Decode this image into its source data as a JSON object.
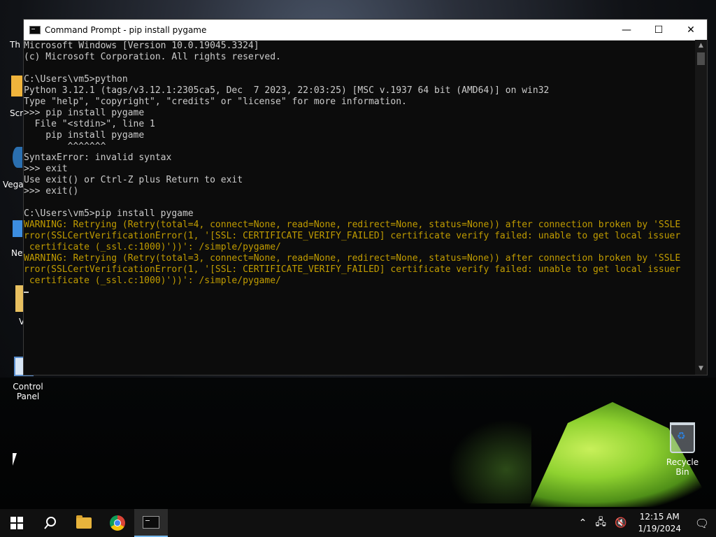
{
  "desktop": {
    "icons": [
      {
        "label": "Th",
        "name": "desktop-icon-this-pc"
      },
      {
        "label": "Scre",
        "name": "desktop-icon-screen"
      },
      {
        "label": "Vegas",
        "name": "desktop-icon-vegas"
      },
      {
        "label": "Net",
        "name": "desktop-icon-network"
      },
      {
        "label": "V",
        "name": "desktop-icon-folder"
      },
      {
        "label": "Control Panel",
        "name": "desktop-icon-control-panel"
      },
      {
        "label": "Recycle Bin",
        "name": "desktop-icon-recycle-bin"
      }
    ]
  },
  "window": {
    "title": "Command Prompt - pip  install pygame",
    "minimize_glyph": "—",
    "maximize_glyph": "☐",
    "close_glyph": "✕",
    "lines": [
      {
        "text": "Microsoft Windows [Version 10.0.19045.3324]",
        "type": "normal"
      },
      {
        "text": "(c) Microsoft Corporation. All rights reserved.",
        "type": "normal"
      },
      {
        "text": "",
        "type": "normal"
      },
      {
        "text": "C:\\Users\\vm5>python",
        "type": "normal"
      },
      {
        "text": "Python 3.12.1 (tags/v3.12.1:2305ca5, Dec  7 2023, 22:03:25) [MSC v.1937 64 bit (AMD64)] on win32",
        "type": "normal"
      },
      {
        "text": "Type \"help\", \"copyright\", \"credits\" or \"license\" for more information.",
        "type": "normal"
      },
      {
        "text": ">>> pip install pygame",
        "type": "normal"
      },
      {
        "text": "  File \"<stdin>\", line 1",
        "type": "normal"
      },
      {
        "text": "    pip install pygame",
        "type": "normal"
      },
      {
        "text": "        ^^^^^^^",
        "type": "normal"
      },
      {
        "text": "SyntaxError: invalid syntax",
        "type": "normal"
      },
      {
        "text": ">>> exit",
        "type": "normal"
      },
      {
        "text": "Use exit() or Ctrl-Z plus Return to exit",
        "type": "normal"
      },
      {
        "text": ">>> exit()",
        "type": "normal"
      },
      {
        "text": "",
        "type": "normal"
      },
      {
        "text": "C:\\Users\\vm5>pip install pygame",
        "type": "normal"
      },
      {
        "text": "WARNING: Retrying (Retry(total=4, connect=None, read=None, redirect=None, status=None)) after connection broken by 'SSLE",
        "type": "warn"
      },
      {
        "text": "rror(SSLCertVerificationError(1, '[SSL: CERTIFICATE_VERIFY_FAILED] certificate verify failed: unable to get local issuer",
        "type": "warn"
      },
      {
        "text": " certificate (_ssl.c:1000)'))': /simple/pygame/",
        "type": "warn"
      },
      {
        "text": "WARNING: Retrying (Retry(total=3, connect=None, read=None, redirect=None, status=None)) after connection broken by 'SSLE",
        "type": "warn"
      },
      {
        "text": "rror(SSLCertVerificationError(1, '[SSL: CERTIFICATE_VERIFY_FAILED] certificate verify failed: unable to get local issuer",
        "type": "warn"
      },
      {
        "text": " certificate (_ssl.c:1000)'))': /simple/pygame/",
        "type": "warn"
      }
    ]
  },
  "taskbar": {
    "icons": [
      "windows-start-icon",
      "search-icon",
      "file-explorer-icon",
      "chrome-icon",
      "command-prompt-icon"
    ],
    "tray": {
      "chevron": "⌃",
      "network_glyph": "🖧",
      "volume_glyph": "🔇",
      "time": "12:15 AM",
      "date": "1/19/2024",
      "notification_glyph": "🗨"
    }
  },
  "colors": {
    "console_text": "#cccccc",
    "warning_text": "#c19c00",
    "console_bg": "#0c0c0c",
    "taskbar_bg": "#101010"
  }
}
